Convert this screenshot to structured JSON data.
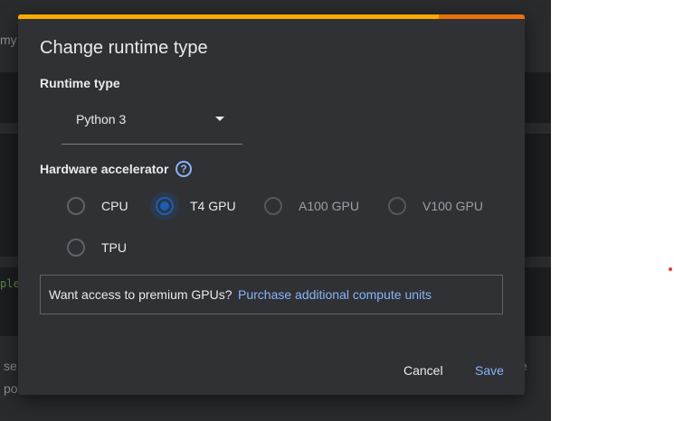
{
  "background": {
    "snippet_top_left": "my",
    "snippet_code_left": "ple",
    "snippet_bottom_left_1": "se",
    "snippet_bottom_left_2": "po",
    "snippet_bottom_right": "e"
  },
  "dialog": {
    "title": "Change runtime type",
    "progress": 0.83,
    "runtime_type": {
      "label": "Runtime type",
      "selected": "Python 3"
    },
    "hardware_accelerator": {
      "label": "Hardware accelerator",
      "help_icon": "?",
      "options": [
        {
          "label": "CPU",
          "selected": false,
          "disabled": false
        },
        {
          "label": "T4 GPU",
          "selected": true,
          "disabled": false
        },
        {
          "label": "A100 GPU",
          "selected": false,
          "disabled": true
        },
        {
          "label": "V100 GPU",
          "selected": false,
          "disabled": true
        },
        {
          "label": "TPU",
          "selected": false,
          "disabled": false
        }
      ]
    },
    "premium": {
      "text": "Want access to premium GPUs?",
      "link": "Purchase additional compute units"
    },
    "buttons": {
      "cancel": "Cancel",
      "save": "Save"
    }
  },
  "colors": {
    "accent": "#8ab4f8",
    "radio_selected": "#1a5fb4",
    "progress_primary": "#f9ab00",
    "progress_secondary": "#e8710a",
    "dialog_bg": "#303134"
  }
}
